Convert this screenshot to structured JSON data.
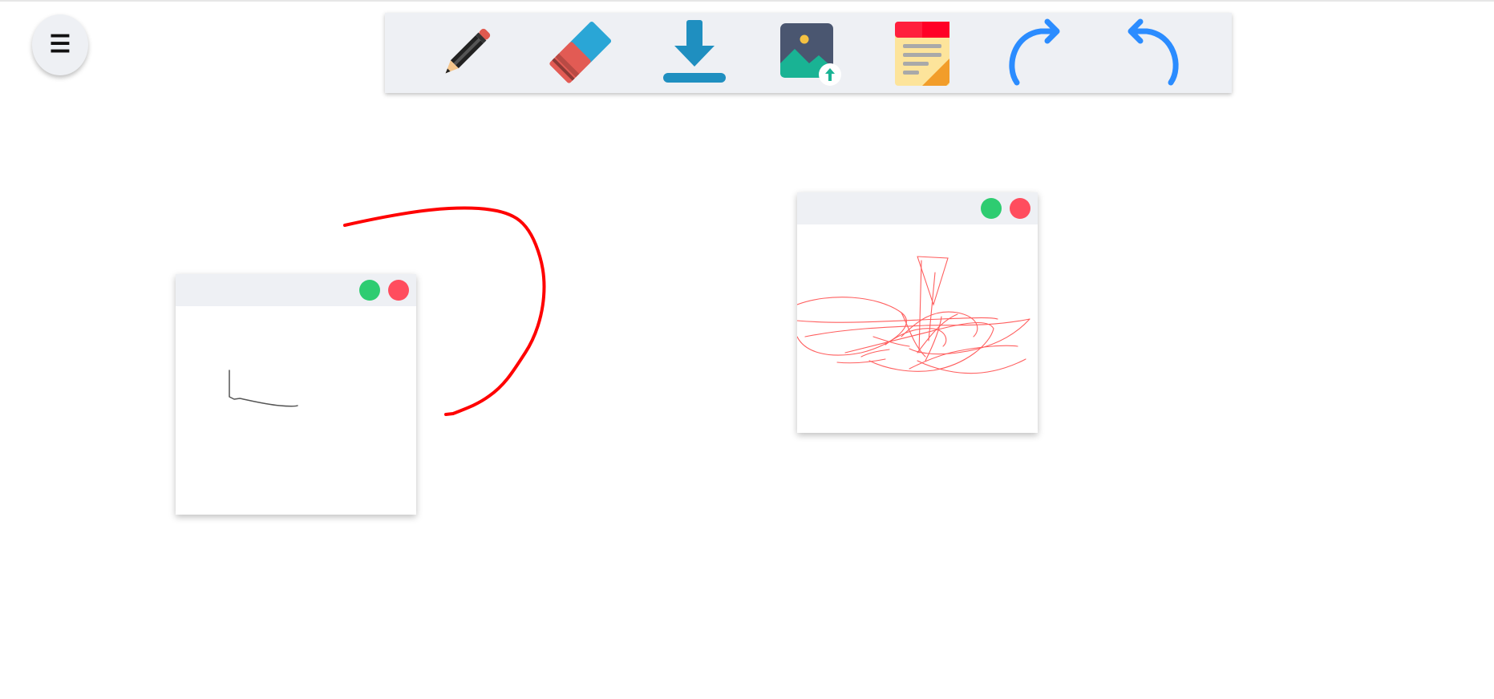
{
  "toolbar": {
    "tools": [
      {
        "id": "pencil",
        "icon": "pencil-icon"
      },
      {
        "id": "eraser",
        "icon": "eraser-icon"
      },
      {
        "id": "download",
        "icon": "download-icon"
      },
      {
        "id": "image-upload",
        "icon": "image-upload-icon"
      },
      {
        "id": "sticky-note",
        "icon": "sticky-note-icon"
      },
      {
        "id": "redo",
        "icon": "redo-icon"
      },
      {
        "id": "undo",
        "icon": "undo-icon"
      }
    ]
  },
  "menu": {
    "icon": "hamburger-icon",
    "glyph": "☰"
  },
  "colors": {
    "toolbar_bg": "#eef0f4",
    "stroke_red": "#ff0000",
    "note_dot_green": "#2ecc71",
    "note_dot_red": "#ff4d5e",
    "arrow_blue": "#2b8cff",
    "download_blue": "#1f8fc0"
  },
  "notes": [
    {
      "id": "note-1",
      "drawing": "small-l-shaped-stroke",
      "stroke_color": "#555555"
    },
    {
      "id": "note-2",
      "drawing": "red-scribble",
      "stroke_color": "#ff4d4d"
    }
  ]
}
